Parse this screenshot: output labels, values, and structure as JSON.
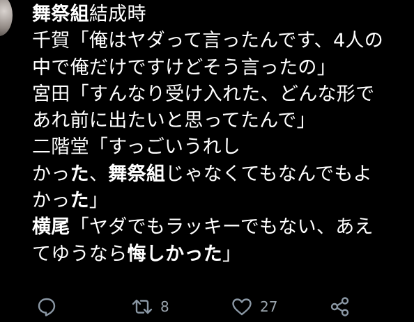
{
  "tweet": {
    "lines": [
      {
        "segments": [
          {
            "text": "舞祭組",
            "bold": true
          },
          {
            "text": "結成時",
            "bold": false
          }
        ]
      },
      {
        "segments": [
          {
            "text": "千賀「俺はヤダって言ったんです、4人の",
            "bold": false
          }
        ]
      },
      {
        "segments": [
          {
            "text": "中で俺だけですけどそう言ったの」",
            "bold": false
          }
        ]
      },
      {
        "segments": [
          {
            "text": "宮田「すんなり受け入れた、どんな形で",
            "bold": false
          }
        ]
      },
      {
        "segments": [
          {
            "text": "あれ前に出たいと思ってたんで」",
            "bold": false
          }
        ]
      },
      {
        "segments": [
          {
            "text": "二階堂「すっごいうれし",
            "bold": false
          }
        ]
      },
      {
        "segments": [
          {
            "text": "かっ",
            "bold": false
          },
          {
            "text": "た",
            "bold": true
          },
          {
            "text": "、",
            "bold": false
          },
          {
            "text": "舞祭組",
            "bold": true
          },
          {
            "text": "じゃなくてもなんでもよ",
            "bold": false
          }
        ]
      },
      {
        "segments": [
          {
            "text": "かっ",
            "bold": false
          },
          {
            "text": "た",
            "bold": true
          },
          {
            "text": "」",
            "bold": false
          }
        ]
      },
      {
        "segments": [
          {
            "text": "横尾",
            "bold": true
          },
          {
            "text": "「ヤダでもラッキーでもない、あえ",
            "bold": false
          }
        ]
      },
      {
        "segments": [
          {
            "text": "てゆうなら",
            "bold": false
          },
          {
            "text": "悔しかった",
            "bold": true
          },
          {
            "text": "」",
            "bold": false
          }
        ]
      }
    ]
  },
  "actions": {
    "reply_icon": "reply-icon",
    "retweet_icon": "retweet-icon",
    "retweet_count": "8",
    "like_icon": "heart-icon",
    "like_count": "27",
    "share_icon": "share-icon"
  },
  "colors": {
    "background": "#000000",
    "text": "#ffffff",
    "icon": "#8b98a5"
  }
}
